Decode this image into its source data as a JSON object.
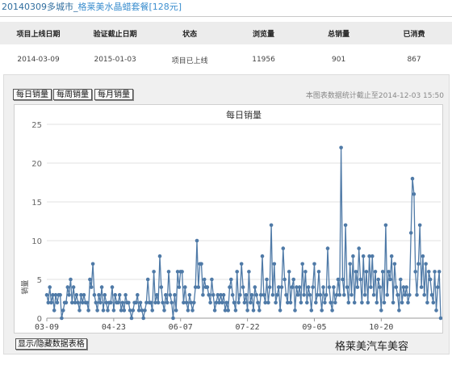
{
  "page": {
    "title_code": "20140309",
    "title_city": "多城市_",
    "title_name": "格莱美水晶蜡套餐",
    "title_price": "[128元]"
  },
  "info_table": {
    "headers": [
      "项目上线日期",
      "验证截止日期",
      "状态",
      "浏览量",
      "总销量",
      "已消费"
    ],
    "row": [
      "2014-03-09",
      "2015-01-03",
      "项目已上线",
      "11956",
      "901",
      "867"
    ]
  },
  "tabs": {
    "daily": "每日销量",
    "weekly": "每周销量",
    "monthly": "每月销量"
  },
  "stat_note": "本图表数据统计截止至2014-12-03 15:50",
  "toggle_label": "显示/隐藏数据表格",
  "watermark": "格莱美汽车美容",
  "colors": {
    "series": "#4f7aa7",
    "title_link": "#2f6d9e"
  },
  "chart_data": {
    "type": "line",
    "title": "每日销量",
    "ylabel": "销量",
    "xlabel": "",
    "ylim": [
      0,
      25
    ],
    "yticks": [
      0,
      5,
      10,
      15,
      20,
      25
    ],
    "xtick_labels": [
      "03-09",
      "04-23",
      "06-07",
      "07-22",
      "09-05",
      "10-20"
    ],
    "x_start": "2014-03-09",
    "grid": "horizontal",
    "series": [
      {
        "values": [
          3,
          2,
          4,
          2,
          3,
          1,
          3,
          2,
          3,
          3,
          0,
          1,
          2,
          2,
          4,
          3,
          5,
          2,
          4,
          2,
          3,
          2,
          1,
          3,
          2,
          3,
          2,
          2,
          1,
          5,
          4,
          7,
          3,
          2,
          1,
          3,
          2,
          4,
          1,
          3,
          2,
          1,
          2,
          2,
          4,
          1,
          3,
          2,
          2,
          3,
          1,
          2,
          1,
          3,
          2,
          2,
          1,
          0,
          1,
          2,
          2,
          3,
          1,
          2,
          1,
          0,
          1,
          2,
          5,
          2,
          2,
          1,
          6,
          2,
          3,
          2,
          8,
          4,
          2,
          1,
          3,
          2,
          6,
          3,
          2,
          0,
          3,
          1,
          6,
          4,
          6,
          6,
          2,
          4,
          2,
          1,
          3,
          2,
          1,
          2,
          4,
          10,
          4,
          7,
          7,
          3,
          5,
          4,
          4,
          3,
          2,
          5,
          3,
          1,
          2,
          3,
          2,
          3,
          2,
          3,
          1,
          2,
          1,
          4,
          5,
          3,
          2,
          1,
          6,
          2,
          3,
          7,
          4,
          2,
          3,
          1,
          6,
          2,
          3,
          1,
          4,
          3,
          2,
          1,
          3,
          8,
          3,
          2,
          5,
          2,
          4,
          12,
          3,
          7,
          2,
          3,
          4,
          1,
          4,
          9,
          5,
          3,
          2,
          6,
          2,
          4,
          5,
          1,
          4,
          3,
          4,
          2,
          7,
          3,
          6,
          2,
          4,
          3,
          1,
          4,
          7,
          2,
          3,
          6,
          3,
          1,
          4,
          2,
          3,
          9,
          4,
          2,
          1,
          4,
          2,
          3,
          5,
          3,
          22,
          5,
          3,
          12,
          4,
          2,
          7,
          3,
          8,
          2,
          6,
          4,
          9,
          5,
          2,
          8,
          3,
          6,
          2,
          8,
          4,
          8,
          3,
          6,
          2,
          5,
          4,
          1,
          6,
          2,
          12,
          3,
          6,
          5,
          8,
          2,
          7,
          4,
          3,
          1,
          5,
          2,
          4,
          3,
          4,
          2,
          3,
          11,
          18,
          16,
          6,
          3,
          7,
          12,
          4,
          8,
          3,
          7,
          2,
          6,
          5,
          3,
          2,
          6,
          1,
          4,
          6,
          0
        ]
      }
    ]
  }
}
